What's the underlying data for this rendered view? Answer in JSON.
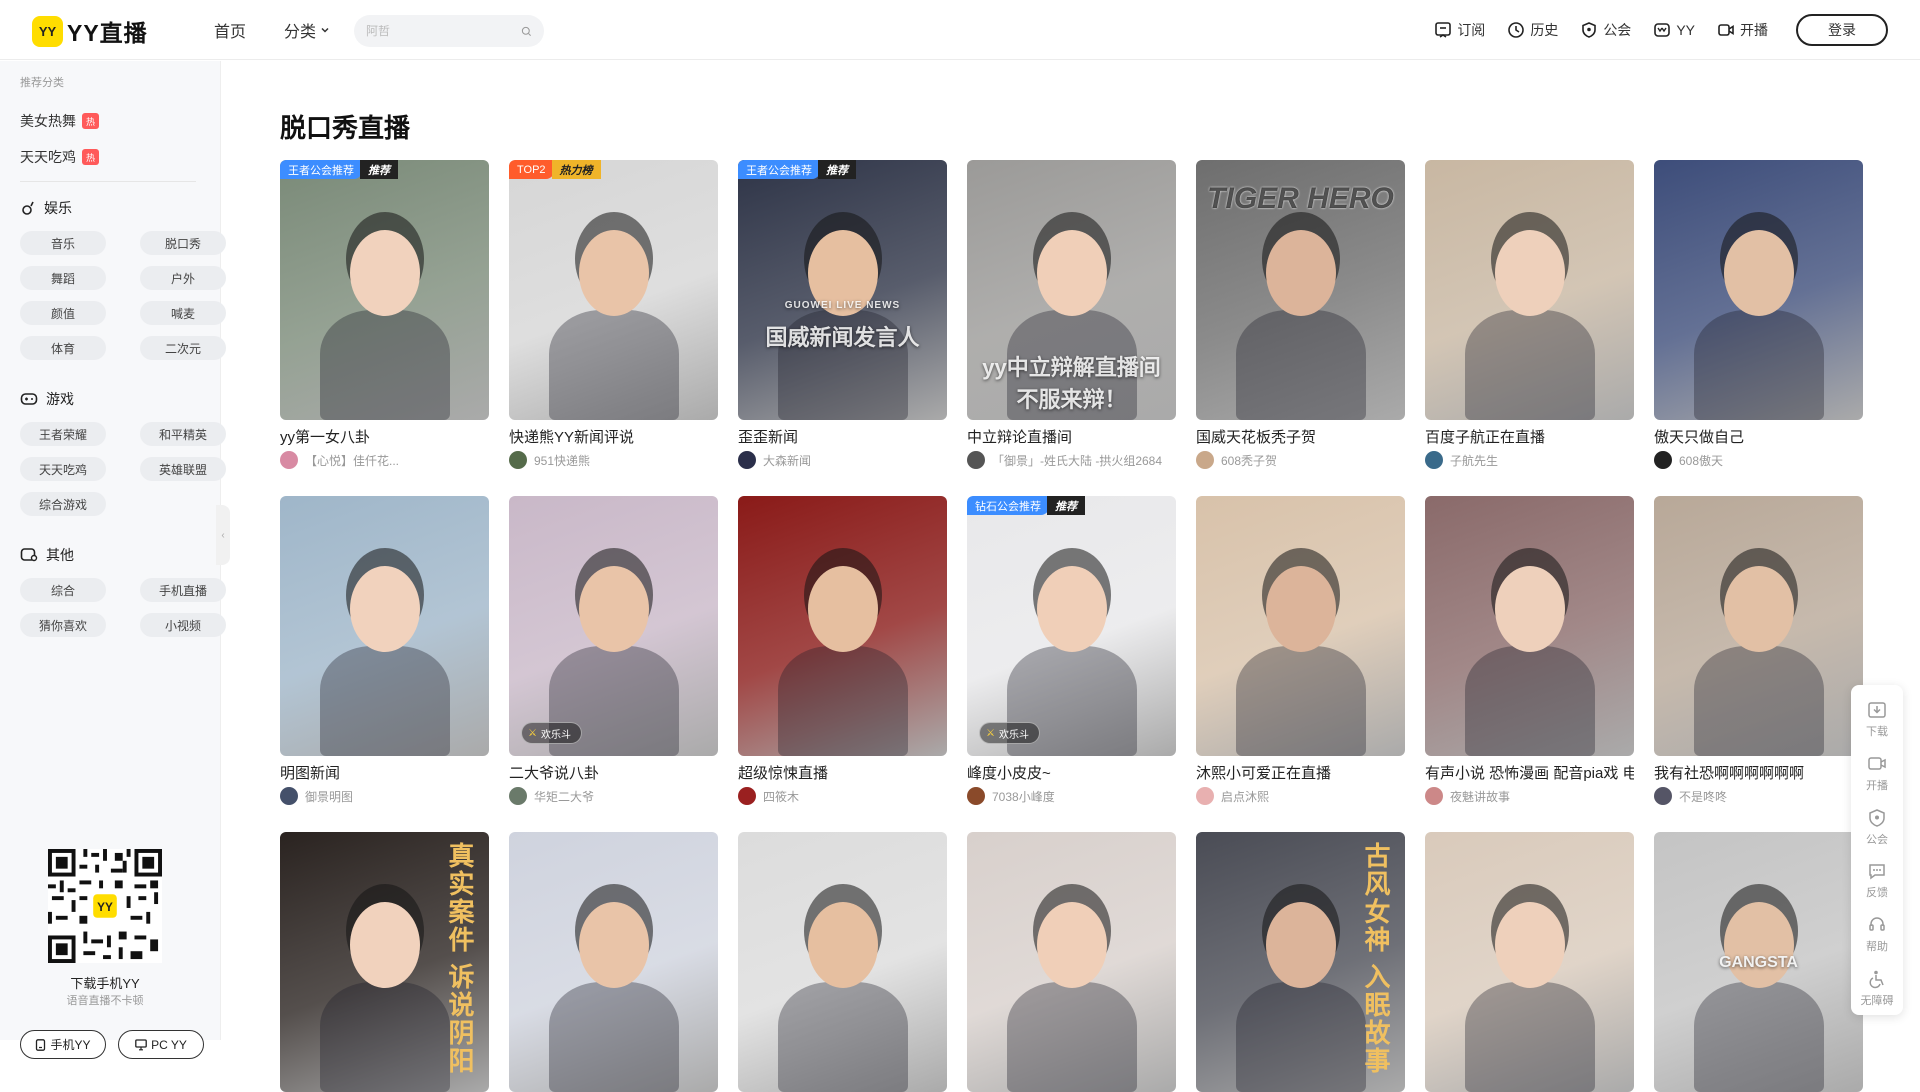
{
  "header": {
    "logo_badge": "YY",
    "logo_text": "YY直播",
    "nav": [
      {
        "label": "首页"
      },
      {
        "label": "分类"
      }
    ],
    "search_placeholder": "阿哲",
    "right_items": [
      {
        "label": "订阅",
        "icon": "subscribe-icon"
      },
      {
        "label": "历史",
        "icon": "history-icon"
      },
      {
        "label": "公会",
        "icon": "guild-icon"
      },
      {
        "label": "YY",
        "icon": "yy-icon"
      },
      {
        "label": "开播",
        "icon": "broadcast-icon"
      }
    ],
    "login_label": "登录"
  },
  "sidebar": {
    "section_title": "推荐分类",
    "hot": [
      {
        "label": "美女热舞",
        "badge": "热"
      },
      {
        "label": "天天吃鸡",
        "badge": "热"
      }
    ],
    "groups": [
      {
        "title": "娱乐",
        "icon": "entertainment-icon",
        "items": [
          "音乐",
          "脱口秀",
          "舞蹈",
          "户外",
          "颜值",
          "喊麦",
          "体育",
          "二次元"
        ]
      },
      {
        "title": "游戏",
        "icon": "gamepad-icon",
        "items": [
          "王者荣耀",
          "和平精英",
          "天天吃鸡",
          "英雄联盟",
          "综合游戏"
        ]
      },
      {
        "title": "其他",
        "icon": "other-icon",
        "items": [
          "综合",
          "手机直播",
          "猜你喜欢",
          "小视频"
        ]
      }
    ],
    "qr_center": "YY",
    "download_title": "下载手机YY",
    "download_sub": "语音直播不卡顿",
    "buttons": [
      {
        "label": "手机YY"
      },
      {
        "label": "PC YY"
      }
    ]
  },
  "main": {
    "title": "脱口秀直播",
    "cards": [
      {
        "title": "yy第一女八卦",
        "anchor": "【心悦】佳仟花...",
        "tag1": "王者公会推荐",
        "tag2": "推荐",
        "tag_style": "blue",
        "bg": "#7a8a78",
        "av": "#d88aa3"
      },
      {
        "title": "快递熊YY新闻评说",
        "anchor": "951快递熊",
        "tag1": "TOP2",
        "tag2": "热力榜",
        "tag_style": "red",
        "bg": "#d6d6d6",
        "av": "#556b4a"
      },
      {
        "title": "歪歪新闻",
        "anchor": "大森新闻",
        "tag1": "王者公会推荐",
        "tag2": "推荐",
        "tag_style": "blue",
        "bg": "#2e3447",
        "av": "#2b2f4a",
        "overlay": "国威新闻发言人",
        "overlay_sub": "GUOWEI LIVE NEWS"
      },
      {
        "title": "中立辩论直播间",
        "anchor": "「御景」-姓氏大陆 -拱火组2684",
        "bg": "#9b9a98",
        "av": "#555",
        "overlay": "yy中立辩解直播间",
        "overlay_sub": "不服来辩！"
      },
      {
        "title": "国威天花板秃子贺",
        "anchor": "608秃子贺",
        "bg": "#6e6e6e",
        "av": "#c9a88a",
        "overlay_top": "TIGER HERO"
      },
      {
        "title": "百度子航正在直播",
        "anchor": "子航先生",
        "bg": "#c8b7a2",
        "av": "#3a6a8a"
      },
      {
        "title": "傲天只做自己",
        "anchor": "608傲天",
        "bg": "#3d4d7a",
        "av": "#222"
      },
      {
        "title": "明图新闻",
        "anchor": "御景明图",
        "bg": "#9fb6c9",
        "av": "#44506a"
      },
      {
        "title": "二大爷说八卦",
        "anchor": "华矩二大爷",
        "bg": "#c9b8c8",
        "av": "#6a7a6a",
        "pk": "欢乐斗"
      },
      {
        "title": "超级惊悚直播",
        "anchor": "四筱木",
        "bg": "#8a1a18",
        "av": "#9a2020"
      },
      {
        "title": "峰度小皮皮~",
        "anchor": "7038小峰度",
        "tag1": "钻石公会推荐",
        "tag2": "推荐",
        "tag_style": "blue",
        "bg": "#e8e8ea",
        "av": "#8a4a2a",
        "pk": "欢乐斗"
      },
      {
        "title": "沐熙小可爱正在直播",
        "anchor": "启点沐熙",
        "bg": "#d8c2aa",
        "av": "#e8b0b0"
      },
      {
        "title": "有声小说 恐怖漫画 配音pia戏 电",
        "anchor": "夜魅讲故事",
        "bg": "#8a6a6a",
        "av": "#c88"
      },
      {
        "title": "我有社恐啊啊啊啊啊啊",
        "anchor": "不是咚咚",
        "bg": "#b8a898",
        "av": "#556"
      },
      {
        "title": "",
        "anchor": "",
        "bg": "#2a2320",
        "overlay_vert": "真实案件 诉说阴阳"
      },
      {
        "title": "",
        "anchor": "",
        "bg": "#cfd3de"
      },
      {
        "title": "",
        "anchor": "",
        "bg": "#dcdcdc"
      },
      {
        "title": "",
        "anchor": "",
        "bg": "#d8d0cc"
      },
      {
        "title": "",
        "anchor": "",
        "bg": "#4a4c55",
        "overlay_vert": "古风女神 入眠故事"
      },
      {
        "title": "",
        "anchor": "",
        "bg": "#d9cabb"
      },
      {
        "title": "",
        "anchor": "",
        "bg": "#c4c4c4",
        "overlay_shirt": "GANGSTA"
      }
    ]
  },
  "float_bar": [
    {
      "label": "下载",
      "icon": "download-icon"
    },
    {
      "label": "开播",
      "icon": "broadcast-icon"
    },
    {
      "label": "公会",
      "icon": "guild-icon"
    },
    {
      "label": "反馈",
      "icon": "feedback-icon"
    },
    {
      "label": "帮助",
      "icon": "help-icon"
    },
    {
      "label": "无障碍",
      "icon": "accessibility-icon"
    }
  ],
  "colors": {
    "accent": "#ffdd00",
    "hot": "#ff5a5a",
    "tag_blue": "#3c8dff",
    "tag_red": "#ff5c2b"
  }
}
